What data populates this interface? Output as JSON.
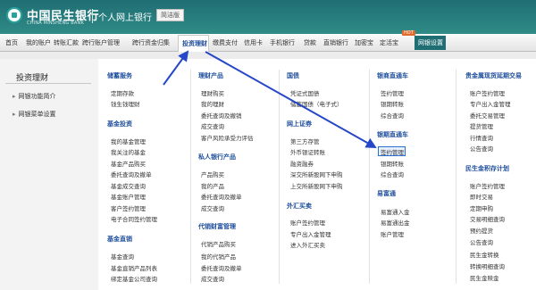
{
  "header": {
    "bank_name_cn": "中国民生银行",
    "bank_name_en": "CHINA MINSHENG BANK",
    "site_name": "个人网上银行",
    "badge": "简洁版",
    "brand_color": "#1f6e74"
  },
  "nav": {
    "items": [
      "首页",
      "我的账户",
      "转账汇款",
      "跨行账户管理",
      "跨行资金归集",
      "投资理财",
      "缴费支付",
      "信用卡",
      "手机银行",
      "贷款",
      "直销银行",
      "加密宝",
      "定活宝",
      "网银设置"
    ],
    "active": "投资理财",
    "hot_badge": "HOT"
  },
  "left": {
    "title": "投资理财",
    "items": [
      "网银功能简介",
      "网银菜单设置"
    ]
  },
  "columns": {
    "col1": [
      {
        "title": "储蓄服务",
        "links": [
          "定期存款",
          "钱生钱理财"
        ]
      },
      {
        "title": "基金投资",
        "links": [
          "我的基金管理",
          "我关注的基金",
          "基金产品购买",
          "委托查询及撤单",
          "基金成交查询",
          "基金账户管理",
          "客户签约管理",
          "电子合同签约管理"
        ]
      },
      {
        "title": "基金直销",
        "links": [
          "基金查询",
          "基金直销产品列表",
          "绑定基金公司查询"
        ]
      }
    ],
    "col2": [
      {
        "title": "理财产品",
        "links": [
          "理财购买",
          "我的理财",
          "委托查询及撤销",
          "成交查询",
          "客户风险承受力评估"
        ]
      },
      {
        "title": "私人银行产品",
        "links": [
          "产品购买",
          "我的产品",
          "委托查询及撤单",
          "成交查询"
        ]
      },
      {
        "title": "代销财富管理",
        "links": [
          "代销产品购买",
          "我的代销产品",
          "委托查询及撤单",
          "成交查询"
        ]
      }
    ],
    "col3": [
      {
        "title": "国债",
        "links": [
          "凭证式国债",
          "储蓄国债（电子式）"
        ]
      },
      {
        "title": "网上证券",
        "links": [
          "第三方存管",
          "外币银证转账",
          "融资融券",
          "深交所新股网下申购",
          "上交所新股网下申购"
        ]
      },
      {
        "title": "外汇买卖",
        "links": [
          "账户签约管理",
          "专户出入金管理",
          "进入外汇买卖"
        ]
      }
    ],
    "col4": [
      {
        "title": "银商直通车",
        "links": [
          "签约管理",
          "银期转账",
          "综合查询"
        ]
      },
      {
        "title": "银期直通车",
        "links": [
          "签约管理",
          "银期转账",
          "综合查询"
        ]
      },
      {
        "title": "易富通",
        "links": [
          "易富通入金",
          "易富通出金",
          "账户管理"
        ]
      }
    ],
    "col5": [
      {
        "title": "贵金属现货延期交易",
        "links": [
          "账户签约管理",
          "专户出入金管理",
          "委托交易管理",
          "提货管理",
          "行情查询",
          "公告查询"
        ]
      },
      {
        "title": "民生金积存计划",
        "links": [
          "账户签约管理",
          "即时交易",
          "定期申购",
          "交易明细查询",
          "预约提货",
          "公告查询",
          "民生金转换",
          "转换明细查询",
          "民生金赎金"
        ]
      }
    ]
  }
}
